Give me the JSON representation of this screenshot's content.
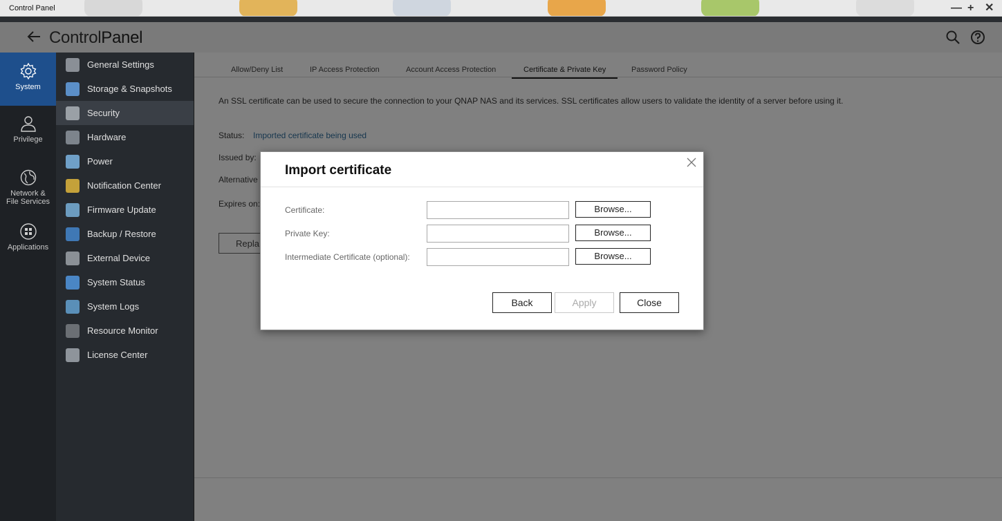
{
  "window": {
    "title": "Control Panel",
    "controls": {
      "minimize": "—",
      "maximize": "+",
      "close": "✕"
    }
  },
  "header": {
    "title_part1": "Control",
    "title_part2": "Panel",
    "icons": [
      "back-arrow-icon",
      "search-icon",
      "help-icon"
    ]
  },
  "categories": [
    {
      "label": "System",
      "icon": "gear-icon",
      "active": true
    },
    {
      "label": "Privilege",
      "icon": "user-icon",
      "active": false
    },
    {
      "label_line1": "Network &",
      "label_line2": "File Services",
      "icon": "globe-icon",
      "active": false
    },
    {
      "label": "Applications",
      "icon": "apps-grid-icon",
      "active": false
    }
  ],
  "menu": {
    "items": [
      {
        "label": "General Settings",
        "color": "#8a8f96"
      },
      {
        "label": "Storage & Snapshots",
        "color": "#5b8fc7"
      },
      {
        "label": "Security",
        "color": "#9aa0a6",
        "active": true
      },
      {
        "label": "Hardware",
        "color": "#7d848c"
      },
      {
        "label": "Power",
        "color": "#6fa0c8"
      },
      {
        "label": "Notification Center",
        "color": "#c4a13a"
      },
      {
        "label": "Firmware Update",
        "color": "#6c9cc0"
      },
      {
        "label": "Backup / Restore",
        "color": "#3f78b5"
      },
      {
        "label": "External Device",
        "color": "#8b9096"
      },
      {
        "label": "System Status",
        "color": "#4a86c5"
      },
      {
        "label": "System Logs",
        "color": "#5a8fb8"
      },
      {
        "label": "Resource Monitor",
        "color": "#6b6f74"
      },
      {
        "label": "License Center",
        "color": "#8e949b"
      }
    ]
  },
  "tabs": [
    {
      "label": "Allow/Deny List"
    },
    {
      "label": "IP Access Protection"
    },
    {
      "label": "Account Access Protection"
    },
    {
      "label": "Certificate & Private Key",
      "active": true
    },
    {
      "label": "Password Policy"
    }
  ],
  "content": {
    "description": "An SSL certificate can be used to secure the connection to your QNAP NAS and its services. SSL certificates allow users to validate the identity of a server before using it.",
    "status_label": "Status:",
    "status_value": "Imported certificate being used",
    "issued_by_label": "Issued by:",
    "alternative_label": "Alternative",
    "expires_label": "Expires on:",
    "replace_button": "Repla"
  },
  "modal": {
    "title": "Import certificate",
    "rows": [
      {
        "label": "Certificate:",
        "value": "",
        "browse": "Browse..."
      },
      {
        "label": "Private Key:",
        "value": "",
        "browse": "Browse..."
      },
      {
        "label": "Intermediate Certificate (optional):",
        "value": "",
        "browse": "Browse..."
      }
    ],
    "buttons": {
      "back": "Back",
      "apply": "Apply",
      "close": "Close"
    }
  },
  "colors": {
    "accent": "#1e4f8c",
    "status_link": "#16364e",
    "overlay": "#808080"
  }
}
